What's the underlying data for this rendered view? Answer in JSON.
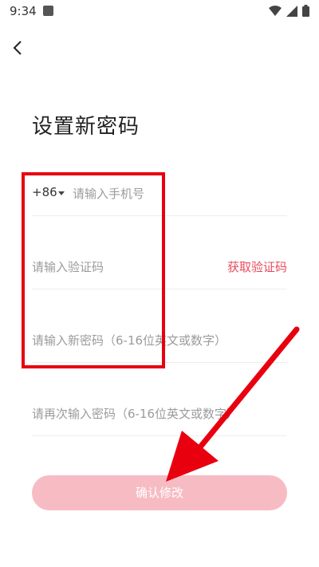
{
  "status": {
    "time": "9:34"
  },
  "page": {
    "title": "设置新密码"
  },
  "form": {
    "country_code": "+86",
    "phone_placeholder": "请输入手机号",
    "code_placeholder": "请输入验证码",
    "get_code_label": "获取验证码",
    "new_password_placeholder": "请输入新密码（6-16位英文或数字）",
    "confirm_password_placeholder": "请再次输入密码（6-16位英文或数字）",
    "confirm_label": "确认修改"
  },
  "colors": {
    "accent": "#e84b5d",
    "button_bg": "#f7bcc3",
    "annotation": "#e8000f"
  }
}
